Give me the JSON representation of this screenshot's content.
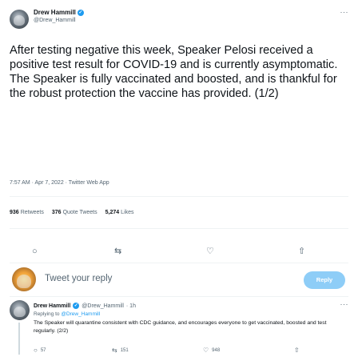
{
  "tweet": {
    "author": {
      "name": "Drew Hammill",
      "handle": "@Drew_Hammill"
    },
    "text": "After testing negative this week, Speaker Pelosi received a positive test result for COVID-19 and is currently asymptomatic. The Speaker is fully vaccinated and boosted, and is thankful for the robust protection the vaccine has provided. (1/2)",
    "meta": "7:57 AM · Apr 7, 2022 · Twitter Web App",
    "stats": {
      "retweets": {
        "count": "936",
        "label": "Retweets"
      },
      "quotes": {
        "count": "376",
        "label": "Quote Tweets"
      },
      "likes": {
        "count": "5,274",
        "label": "Likes"
      }
    }
  },
  "icons": {
    "verified": "✓",
    "more": "···",
    "reply": "○",
    "retweet": "⇆",
    "like": "♡",
    "share": "⇧"
  },
  "compose": {
    "placeholder": "Tweet your reply",
    "reply_label": "Reply"
  },
  "reply_tweet": {
    "author": {
      "name": "Drew Hammill",
      "handle": "@Drew_Hammill",
      "time": "· 1h"
    },
    "replying_label": "Replying to",
    "replying_to": "@Drew_Hammill",
    "text": "The Speaker will quarantine consistent with CDC guidance, and encourages everyone to get vaccinated, boosted and test regularly. (2/2)",
    "counts": {
      "replies": "57",
      "retweets": "151",
      "likes": "948"
    }
  },
  "colors": {
    "accent": "#1d9bf0",
    "reply_button": "#8ecdf7",
    "secondary_text": "#536471",
    "primary_text": "#0f1419"
  }
}
